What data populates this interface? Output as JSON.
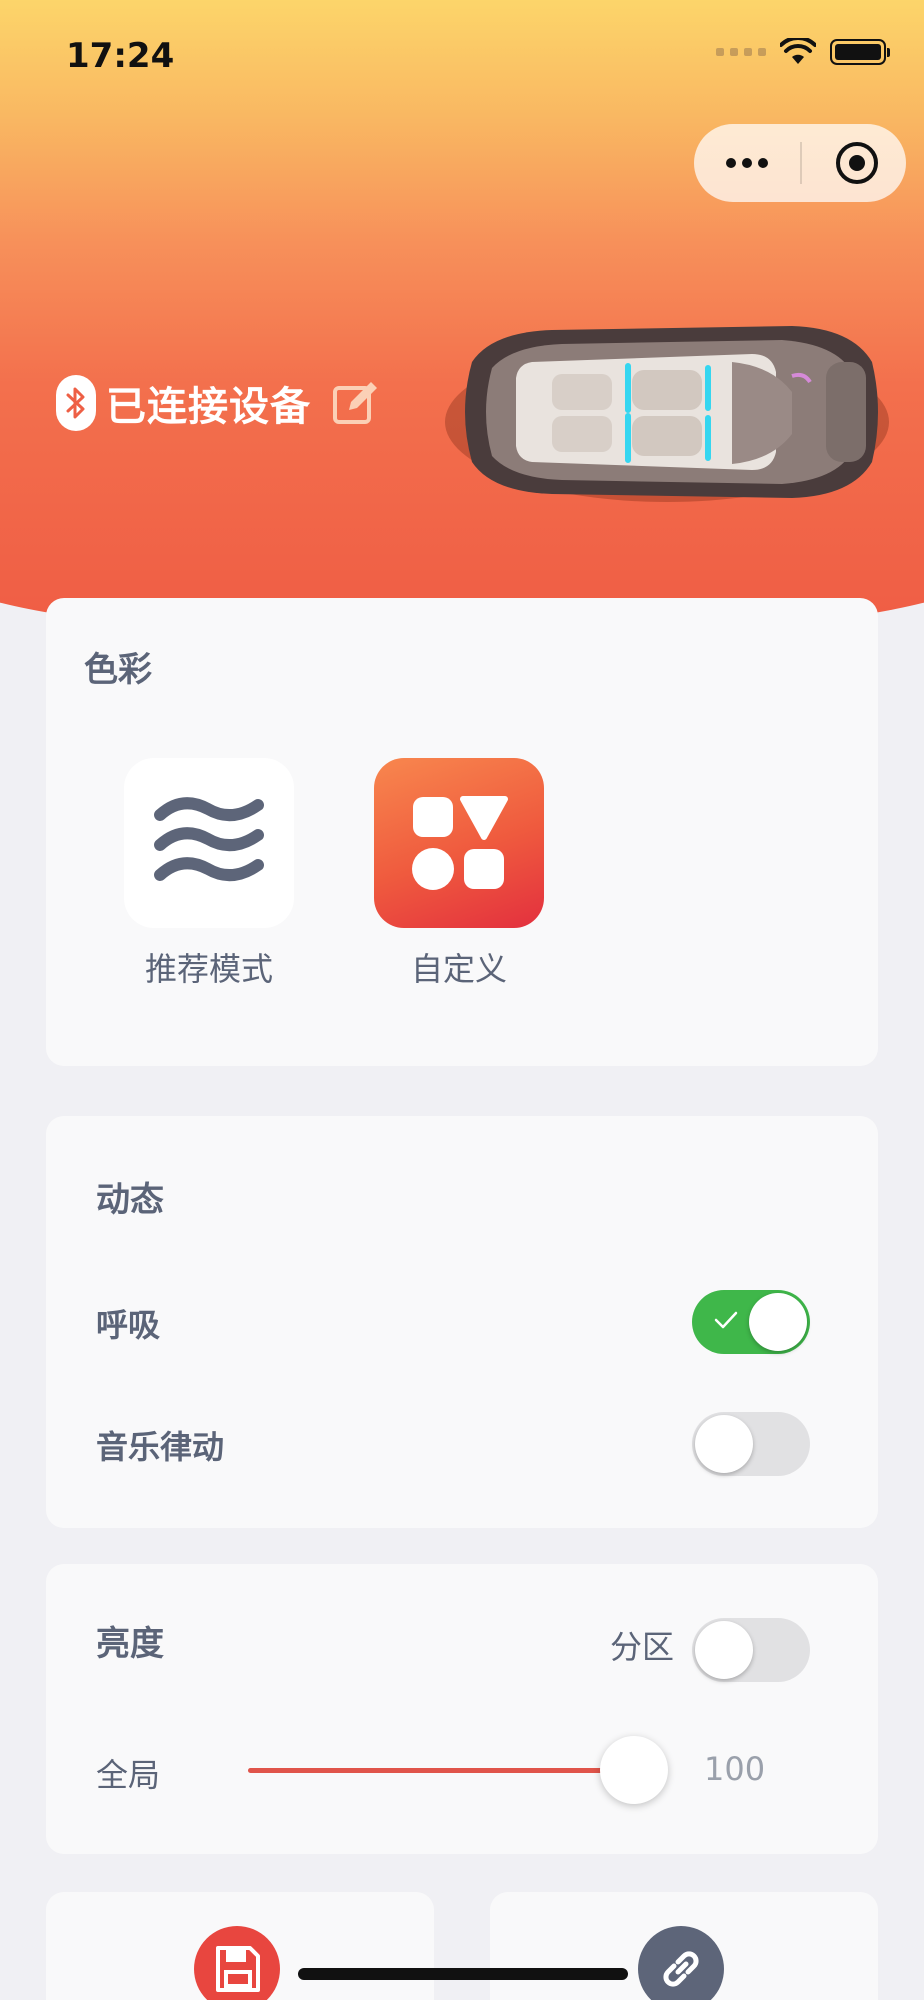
{
  "status_bar": {
    "time": "17:24"
  },
  "header": {
    "device_status": "已连接设备"
  },
  "color_section": {
    "title": "色彩",
    "modes": [
      {
        "label": "推荐模式",
        "icon": "waves-icon"
      },
      {
        "label": "自定义",
        "icon": "shapes-grid-icon"
      }
    ]
  },
  "dynamic_section": {
    "title": "动态",
    "items": [
      {
        "label": "呼吸",
        "enabled": true
      },
      {
        "label": "音乐律动",
        "enabled": false
      }
    ]
  },
  "brightness_section": {
    "title": "亮度",
    "zone_label": "分区",
    "zone_enabled": false,
    "global_label": "全局",
    "global_value": "100",
    "global_fraction": 1.0
  },
  "bottom_actions": [
    {
      "icon": "save-icon",
      "color": "#e8463f"
    },
    {
      "icon": "link-icon",
      "color": "#5d6579"
    }
  ],
  "colors": {
    "accent": "#e0544a",
    "toggle_on": "#3fb74a",
    "text": "#5b6478"
  }
}
